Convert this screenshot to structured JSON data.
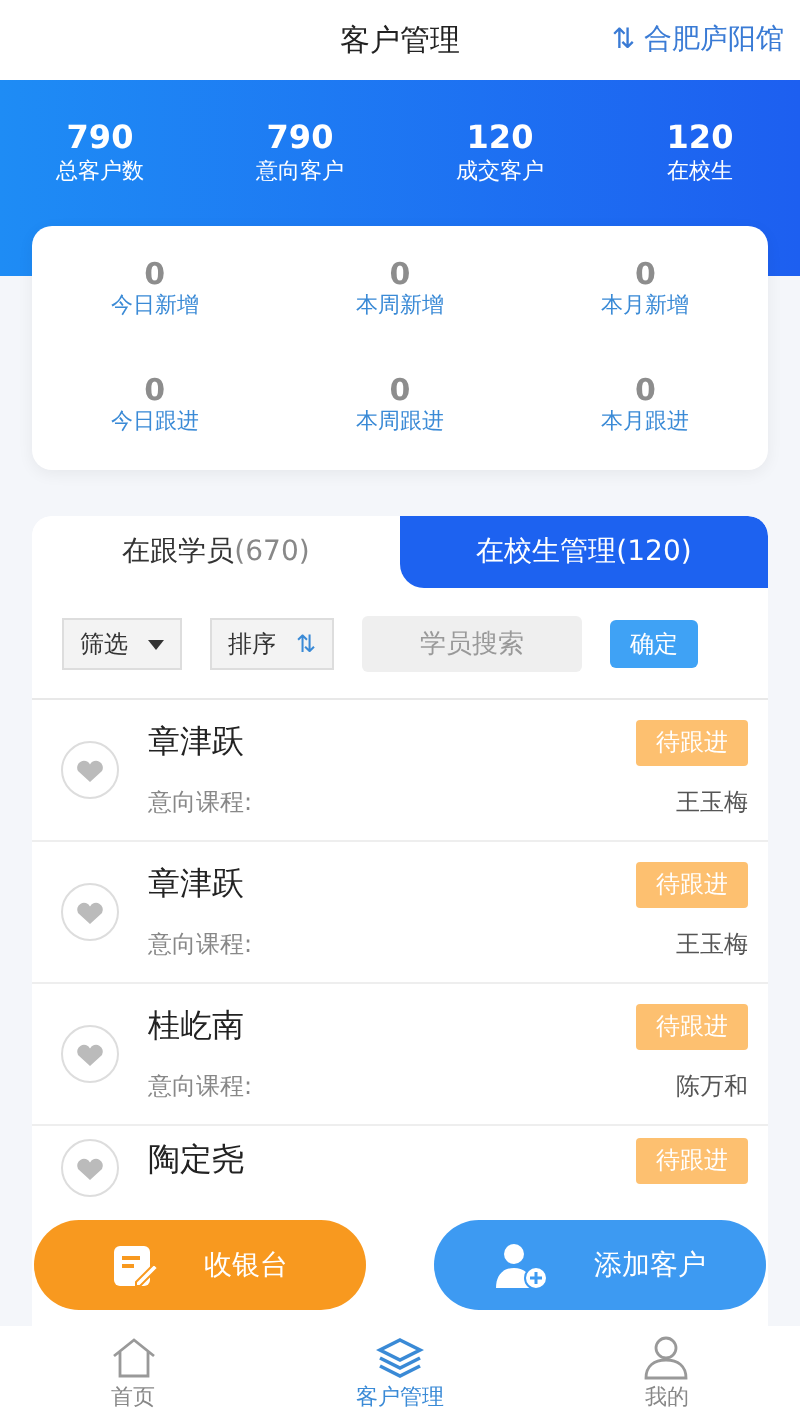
{
  "header": {
    "title": "客户管理",
    "store_icon": "⇅",
    "store": "合肥庐阳馆"
  },
  "summary": [
    {
      "value": "790",
      "label": "总客户数"
    },
    {
      "value": "790",
      "label": "意向客户"
    },
    {
      "value": "120",
      "label": "成交客户"
    },
    {
      "value": "120",
      "label": "在校生"
    }
  ],
  "stats": [
    {
      "value": "0",
      "label": "今日新增"
    },
    {
      "value": "0",
      "label": "本周新增"
    },
    {
      "value": "0",
      "label": "本月新增"
    },
    {
      "value": "0",
      "label": "今日跟进"
    },
    {
      "value": "0",
      "label": "本周跟进"
    },
    {
      "value": "0",
      "label": "本月跟进"
    }
  ],
  "tabs": [
    {
      "label": "在跟学员",
      "count": "(670)",
      "selected": false
    },
    {
      "label": "在校生管理",
      "count": "(120)",
      "selected": true
    }
  ],
  "filters": {
    "filter": "筛选",
    "sort": "排序",
    "sort_icon": "⇅",
    "search_placeholder": "学员搜索",
    "confirm": "确定"
  },
  "students": [
    {
      "name": "章津跃",
      "status": "待跟进",
      "course_label": "意向课程:",
      "teacher": "王玉梅"
    },
    {
      "name": "章津跃",
      "status": "待跟进",
      "course_label": "意向课程:",
      "teacher": "王玉梅"
    },
    {
      "name": "桂屹南",
      "status": "待跟进",
      "course_label": "意向课程:",
      "teacher": "陈万和"
    },
    {
      "name": "陶定尧",
      "status": "待跟进"
    }
  ],
  "actions": [
    {
      "kind": "cashier",
      "label": "收银台"
    },
    {
      "kind": "add",
      "label": "添加客户"
    }
  ],
  "nav": [
    {
      "kind": "home",
      "label": "首页",
      "selected": false
    },
    {
      "kind": "layers",
      "label": "客户管理",
      "selected": true
    },
    {
      "kind": "user",
      "label": "我的",
      "selected": false
    }
  ]
}
